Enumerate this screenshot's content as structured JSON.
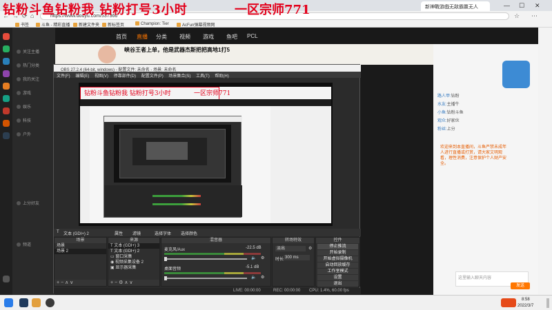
{
  "overlay": {
    "left_text": "钻粉斗鱼钻粉我 钻粉打号3小时",
    "right_text": "一区宗师771"
  },
  "browser": {
    "tabs": [
      "新神戰游戲无敌霸赢无人"
    ],
    "url": "https://www.douyu.com/537366",
    "bookmarks": [
      "书签",
      "斗鱼 - 精彩直播",
      "新建文件夹",
      "新标签页",
      "Champion: Tier",
      "AcFun弹幕视频网"
    ]
  },
  "douyu": {
    "logo": "PCL",
    "nav": [
      "首页",
      "直播",
      "分类",
      "视频",
      "游戏",
      "鱼吧",
      "PCL"
    ],
    "title": "峡谷王者上单，他是武器杰斯把把高地1打5",
    "sidebar": [
      "关注主播",
      "热门分类",
      "我的关注",
      "游戏",
      "娱乐",
      "科技",
      "户外",
      "上分好友",
      "频道"
    ],
    "chat": [
      {
        "user": "路人甲:",
        "text": "钻粉"
      },
      {
        "user": "水友:",
        "text": "主播牛"
      },
      {
        "user": "小鱼:",
        "text": "钻粉斗鱼"
      },
      {
        "user": "观众:",
        "text": "好家伙"
      },
      {
        "user": "粉丝:",
        "text": "上分"
      }
    ],
    "notice": "欢迎来到本直播间，斗鱼严禁未成年人进行直播或打赏，请大家文明观看，理性消费，注意保护个人财产安全。",
    "chat_placeholder": "这里输入聊天内容",
    "send": "发送"
  },
  "obs": {
    "title": "OBS 27.2.4 (64-bit, windows) - 配置文件: 未命名 - 场景: 未命名",
    "menu": [
      "文件(F)",
      "编辑(E)",
      "视图(V)",
      "停靠部件(D)",
      "配置文件(P)",
      "场景集合(S)",
      "工具(T)",
      "帮助(H)"
    ],
    "toolbar": {
      "source_name": "文本 (GDI+) 2",
      "props": "属性",
      "filter": "滤镜",
      "font_sel": "选择字体",
      "edit": "选择颜色"
    },
    "scenes_header": "场景",
    "scenes": [
      "场景",
      "场景 2"
    ],
    "sources_header": "来源",
    "sources": [
      "文本 (GDI+) 3",
      "文本 (GDI+) 2",
      "窗口采集",
      "视频采集设备 2",
      "显示器采集"
    ],
    "mixer_header": "混音器",
    "mixer": [
      {
        "name": "麦克风/Aux",
        "db": "-22.5 dB",
        "level": 0.62
      },
      {
        "name": "桌面音频",
        "db": "-5.1 dB",
        "level": 0.78
      }
    ],
    "transition_header": "转场特效",
    "transition_value": "淡出",
    "duration_label": "时长",
    "duration_value": "300 ms",
    "controls_header": "控件",
    "controls": [
      "停止推流",
      "开始录制",
      "开始虚拟摄像机",
      "启动回放缓存",
      "工作室模式",
      "设置",
      "退出"
    ],
    "status": {
      "live": "LIVE: 00:00:00",
      "rec": "REC: 00:00:00",
      "cpu": "CPU: 1.4%, 60.00 fps"
    }
  },
  "taskbar": {
    "time": "8:58",
    "date": "2022/3/7"
  }
}
